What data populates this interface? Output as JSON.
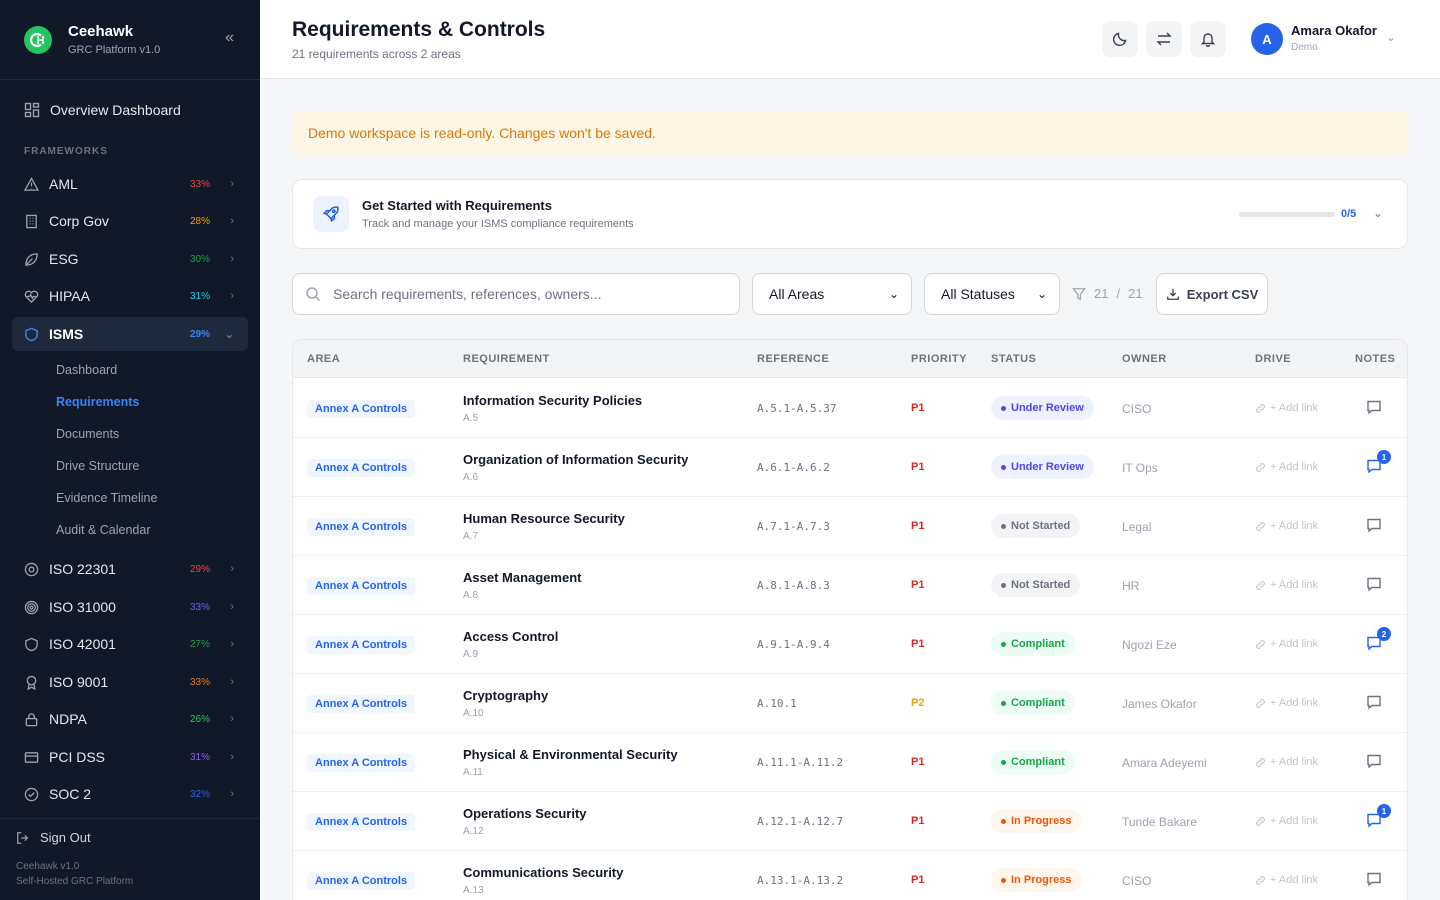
{
  "app": {
    "name": "Ceehawk",
    "subtitle": "GRC Platform v1.0"
  },
  "sidebar": {
    "overview_label": "Overview Dashboard",
    "section_label": "FRAMEWORKS",
    "frameworks": [
      {
        "label": "AML",
        "pct": "33%",
        "pct_color": "#ef4444",
        "icon": "alert-triangle-icon"
      },
      {
        "label": "Corp Gov",
        "pct": "28%",
        "pct_color": "#f59e0b",
        "icon": "building-icon"
      },
      {
        "label": "ESG",
        "pct": "30%",
        "pct_color": "#16a34a",
        "icon": "leaf-icon"
      },
      {
        "label": "HIPAA",
        "pct": "31%",
        "pct_color": "#22d3ee",
        "icon": "heart-pulse-icon"
      },
      {
        "label": "ISMS",
        "pct": "29%",
        "pct_color": "#3b82f6",
        "icon": "shield-icon"
      }
    ],
    "isms_subitems": [
      "Dashboard",
      "Requirements",
      "Documents",
      "Drive Structure",
      "Evidence Timeline",
      "Audit & Calendar"
    ],
    "frameworks_after": [
      {
        "label": "ISO 22301",
        "pct": "29%",
        "pct_color": "#ef4444",
        "icon": "lifebuoy-icon"
      },
      {
        "label": "ISO 31000",
        "pct": "33%",
        "pct_color": "#6366f1",
        "icon": "target-icon"
      },
      {
        "label": "ISO 42001",
        "pct": "27%",
        "pct_color": "#16a34a",
        "icon": "shield-icon"
      },
      {
        "label": "ISO 9001",
        "pct": "33%",
        "pct_color": "#f97316",
        "icon": "award-icon"
      },
      {
        "label": "NDPA",
        "pct": "26%",
        "pct_color": "#22c55e",
        "icon": "lock-icon"
      },
      {
        "label": "PCI DSS",
        "pct": "31%",
        "pct_color": "#8b5cf6",
        "icon": "credit-card-icon"
      },
      {
        "label": "SOC 2",
        "pct": "32%",
        "pct_color": "#2563eb",
        "icon": "check-circle-icon"
      }
    ],
    "sign_out": "Sign Out",
    "version": "Ceehawk v1.0",
    "tagline": "Self-Hosted GRC Platform"
  },
  "header": {
    "title": "Requirements & Controls",
    "subtitle": "21 requirements across 2 areas",
    "user_initial": "A",
    "user_name": "Amara Okafor",
    "user_role": "Demo"
  },
  "banner": "Demo workspace is read-only. Changes won't be saved.",
  "getting_started": {
    "title": "Get Started with Requirements",
    "subtitle": "Track and manage your ISMS compliance requirements",
    "progress": 0,
    "progress_label": "0/5"
  },
  "filters": {
    "search_placeholder": "Search requirements, references, owners...",
    "area": "All Areas",
    "status": "All Statuses",
    "count_shown": "21",
    "count_separator": "/",
    "count_total": "21",
    "export_label": "Export CSV"
  },
  "table": {
    "columns": [
      "AREA",
      "REQUIREMENT",
      "REFERENCE",
      "PRIORITY",
      "STATUS",
      "OWNER",
      "DRIVE",
      "NOTES"
    ],
    "add_link_label": "+ Add link",
    "rows": [
      {
        "area": "Annex A Controls",
        "title": "Information Security Policies",
        "code": "A.5",
        "ref": "A.5.1-A.5.37",
        "priority": "P1",
        "status": "Under Review",
        "owner": "CISO",
        "notes": ""
      },
      {
        "area": "Annex A Controls",
        "title": "Organization of Information Security",
        "code": "A.6",
        "ref": "A.6.1-A.6.2",
        "priority": "P1",
        "status": "Under Review",
        "owner": "IT Ops",
        "notes": "1"
      },
      {
        "area": "Annex A Controls",
        "title": "Human Resource Security",
        "code": "A.7",
        "ref": "A.7.1-A.7.3",
        "priority": "P1",
        "status": "Not Started",
        "owner": "Legal",
        "notes": ""
      },
      {
        "area": "Annex A Controls",
        "title": "Asset Management",
        "code": "A.8",
        "ref": "A.8.1-A.8.3",
        "priority": "P1",
        "status": "Not Started",
        "owner": "HR",
        "notes": ""
      },
      {
        "area": "Annex A Controls",
        "title": "Access Control",
        "code": "A.9",
        "ref": "A.9.1-A.9.4",
        "priority": "P1",
        "status": "Compliant",
        "owner": "Ngozi Eze",
        "notes": "2"
      },
      {
        "area": "Annex A Controls",
        "title": "Cryptography",
        "code": "A.10",
        "ref": "A.10.1",
        "priority": "P2",
        "status": "Compliant",
        "owner": "James Okafor",
        "notes": ""
      },
      {
        "area": "Annex A Controls",
        "title": "Physical & Environmental Security",
        "code": "A.11",
        "ref": "A.11.1-A.11.2",
        "priority": "P1",
        "status": "Compliant",
        "owner": "Amara Adeyemi",
        "notes": ""
      },
      {
        "area": "Annex A Controls",
        "title": "Operations Security",
        "code": "A.12",
        "ref": "A.12.1-A.12.7",
        "priority": "P1",
        "status": "In Progress",
        "owner": "Tunde Bakare",
        "notes": "1"
      },
      {
        "area": "Annex A Controls",
        "title": "Communications Security",
        "code": "A.13",
        "ref": "A.13.1-A.13.2",
        "priority": "P1",
        "status": "In Progress",
        "owner": "CISO",
        "notes": ""
      }
    ]
  },
  "colors": {
    "accent": "#2563eb",
    "p1": "#dc2626",
    "p2": "#f59e0b",
    "under_review_bg": "#eef2ff",
    "under_review_fg": "#4f46e5",
    "not_started_bg": "#f3f4f6",
    "not_started_fg": "#6b7280",
    "compliant_bg": "#ecfdf5",
    "compliant_fg": "#16a34a",
    "in_progress_bg": "#fff7ed",
    "in_progress_fg": "#ea580c"
  }
}
